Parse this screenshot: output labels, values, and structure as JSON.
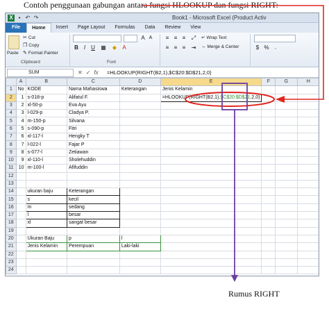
{
  "caption": "Contoh penggunaan gabungan antara fungsi HLOOKUP dan fungsi RIGHT:",
  "footer_caption": "Rumus RIGHT",
  "window": {
    "title": "Book1 - Microsoft Excel (Product Activ"
  },
  "tabs": [
    "File",
    "Home",
    "Insert",
    "Page Layout",
    "Formulas",
    "Data",
    "Review",
    "View"
  ],
  "active_tab": "Home",
  "ribbon": {
    "clipboard": {
      "cut": "Cut",
      "copy": "Copy",
      "paste": "Paste",
      "format_painter": "Format Painter",
      "label": "Clipboard"
    },
    "font": {
      "bold": "B",
      "italic": "I",
      "underline": "U",
      "label": "Font"
    },
    "alignment": {
      "wrap": "Wrap Text",
      "merge": "Merge & Center"
    },
    "number": {
      "currency": "$",
      "percent": "%"
    }
  },
  "formula_bar": {
    "name_box": "SUM",
    "cancel_icon": "✕",
    "enter_icon": "✓",
    "fx": "fx",
    "formula": "=HLOOKUP(RIGHT(B2,1),$C$20:$D$21,2,0)"
  },
  "columns": [
    "A",
    "B",
    "C",
    "D",
    "E",
    "F",
    "G",
    "H"
  ],
  "rows": [
    {
      "n": "1",
      "a": "No",
      "b": "KODE",
      "c": "Nama Mahasiswa",
      "d": "Keterangan",
      "e": "Jenis Kelamin"
    },
    {
      "n": "2",
      "a": "1",
      "b": "s-018-p",
      "c": "Alifatul F.",
      "d": "",
      "e": "=HLOOKUP("
    },
    {
      "n": "3",
      "a": "2",
      "b": "xl-50-p",
      "c": "Eva Ayu",
      "d": "",
      "e": ""
    },
    {
      "n": "4",
      "a": "3",
      "b": "l-029-p",
      "c": "Cladya P.",
      "d": "",
      "e": ""
    },
    {
      "n": "5",
      "a": "4",
      "b": "m-150-p",
      "c": "Silvana",
      "d": "",
      "e": ""
    },
    {
      "n": "6",
      "a": "5",
      "b": "s-090-p",
      "c": "Fitri",
      "d": "",
      "e": ""
    },
    {
      "n": "7",
      "a": "6",
      "b": "xl-117-l",
      "c": "Hengky T",
      "d": "",
      "e": ""
    },
    {
      "n": "8",
      "a": "7",
      "b": "l-022-l",
      "c": "Fajar P",
      "d": "",
      "e": ""
    },
    {
      "n": "9",
      "a": "8",
      "b": "s-077-l",
      "c": "Zetiawan",
      "d": "",
      "e": ""
    },
    {
      "n": "10",
      "a": "9",
      "b": "xl-110-l",
      "c": "Sholehuddin",
      "d": "",
      "e": ""
    },
    {
      "n": "11",
      "a": "10",
      "b": "m-100-l",
      "c": "Afifuddin",
      "d": "",
      "e": ""
    },
    {
      "n": "12"
    },
    {
      "n": "13"
    },
    {
      "n": "14",
      "b": "ukuran baju",
      "c": "Keterangan"
    },
    {
      "n": "15",
      "b": "s",
      "c": "kecil"
    },
    {
      "n": "16",
      "b": "m",
      "c": "sedang"
    },
    {
      "n": "17",
      "b": "l",
      "c": "besar"
    },
    {
      "n": "18",
      "b": "xl",
      "c": "sangat besar"
    },
    {
      "n": "19"
    },
    {
      "n": "20",
      "b": "Ukuran Baju",
      "c": "p",
      "d": "l"
    },
    {
      "n": "21",
      "b": "Jenis Kelamin",
      "c": "Perempuan",
      "d": "Laki-laki"
    },
    {
      "n": "22"
    },
    {
      "n": "23"
    },
    {
      "n": "24"
    }
  ],
  "cell_e2_formula_parts": {
    "prefix": "=HLOOKUP(",
    "right": "RIGHT(B2,1)",
    "range": ",$C$20:$D$21",
    "suffix": ",2,0)"
  },
  "colors": {
    "annotation_red": "#e0261f",
    "annotation_purple": "#6b3fa0",
    "excel_green": "#1f7a3e",
    "file_tab": "#2a73b8"
  }
}
